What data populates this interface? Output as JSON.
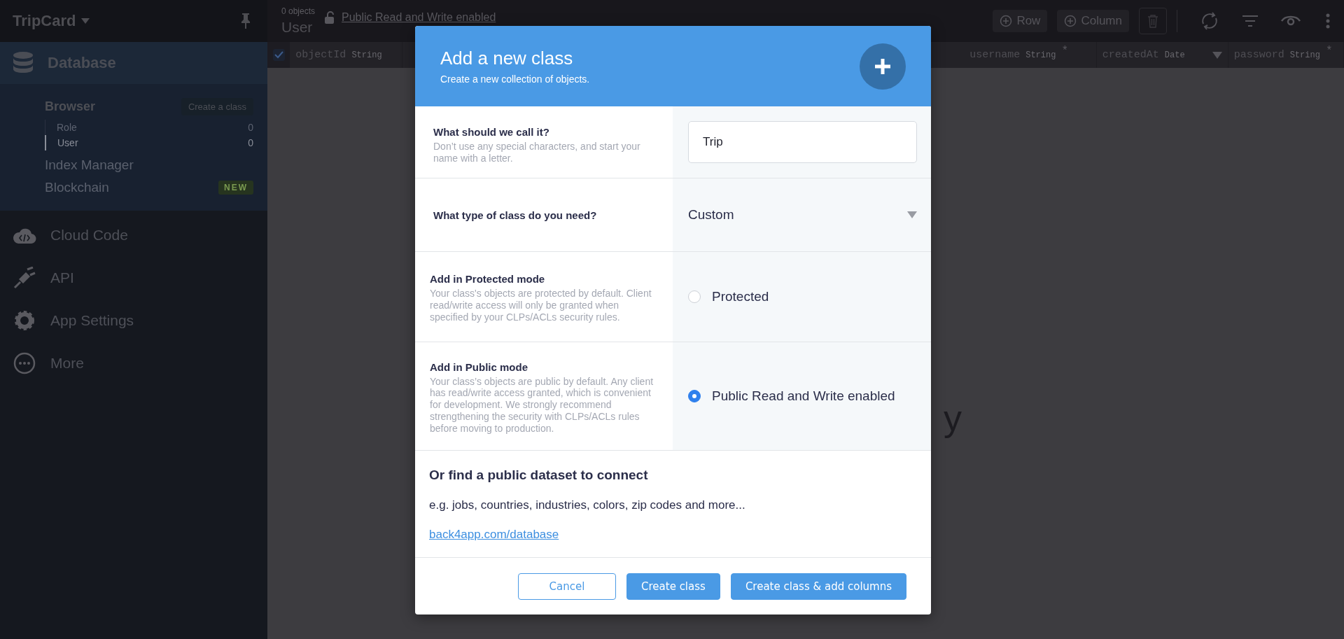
{
  "sidebar": {
    "app_name": "TripCard",
    "database": {
      "label": "Database",
      "selected": true,
      "browser": {
        "label": "Browser",
        "action": "Create a class",
        "classes": [
          {
            "name": "Role",
            "count": "0",
            "selected": false
          },
          {
            "name": "User",
            "count": "0",
            "selected": true
          }
        ]
      },
      "links": [
        {
          "label": "Index Manager"
        },
        {
          "label": "Blockchain",
          "badge": "NEW"
        }
      ]
    },
    "items": [
      {
        "label": "Cloud Code"
      },
      {
        "label": "API"
      },
      {
        "label": "App Settings"
      },
      {
        "label": "More"
      }
    ]
  },
  "toolbar": {
    "count": "0 objects",
    "class_name": "User",
    "permission": "Public Read and Write enabled",
    "buttons": [
      {
        "label": "Row"
      },
      {
        "label": "Column"
      }
    ]
  },
  "table": {
    "select_all_checked": true,
    "columns": [
      {
        "name": "objectId",
        "type": "String",
        "sorted": false
      },
      {
        "name": "username",
        "type": "String",
        "required_mark": "*",
        "sorted": false
      },
      {
        "name": "createdAt",
        "type": "Date",
        "sorted": true
      },
      {
        "name": "password",
        "type": "String",
        "required_mark": "*",
        "sorted": false
      }
    ]
  },
  "background_text": "y",
  "modal": {
    "title": "Add a new class",
    "subtitle": "Create a new collection of objects.",
    "fields": [
      {
        "kind": "text",
        "label": "What should we call it?",
        "hint": "Don’t use any special characters, and start your name with a letter.",
        "value": "Trip"
      },
      {
        "kind": "select",
        "label": "What type of class do you need?",
        "value": "Custom"
      },
      {
        "kind": "radio",
        "label": "Add in Protected mode",
        "hint": "Your class's objects are protected by default. Client read/write access will only be granted when specified by your CLPs/ACLs security rules.",
        "option": "Protected",
        "selected": false
      },
      {
        "kind": "radio",
        "label": "Add in Public mode",
        "hint": "Your class’s objects are public by default. Any client has read/write access granted, which is convenient for development. We strongly recommend strengthening the security with CLPs/ACLs rules before moving to production.",
        "option": "Public Read and Write enabled",
        "selected": true
      }
    ],
    "dataset": {
      "heading": "Or find a public dataset to connect",
      "text": "e.g. jobs, countries, industries, colors, zip codes and more...",
      "link": "back4app.com/database"
    },
    "buttons": [
      {
        "label": "Cancel",
        "kind": "secondary"
      },
      {
        "label": "Create class",
        "kind": "primary"
      },
      {
        "label": "Create class & add columns",
        "kind": "primary"
      }
    ]
  }
}
